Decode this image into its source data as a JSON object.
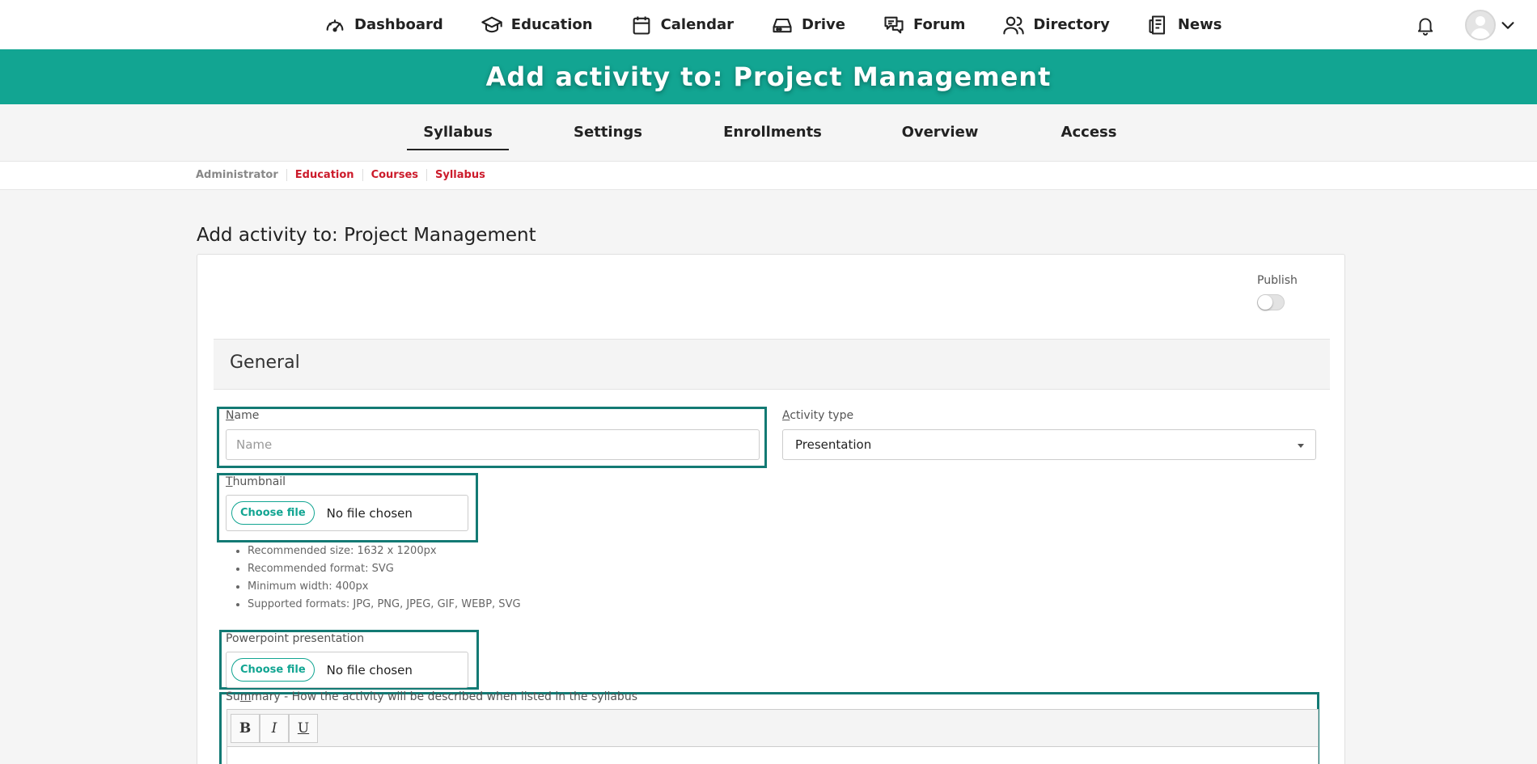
{
  "topnav": {
    "items": [
      {
        "label": "Dashboard",
        "icon": "speedometer-icon"
      },
      {
        "label": "Education",
        "icon": "graduation-cap-icon"
      },
      {
        "label": "Calendar",
        "icon": "calendar-icon"
      },
      {
        "label": "Drive",
        "icon": "drive-icon"
      },
      {
        "label": "Forum",
        "icon": "chat-bubbles-icon"
      },
      {
        "label": "Directory",
        "icon": "users-icon"
      },
      {
        "label": "News",
        "icon": "newspaper-icon"
      }
    ],
    "notification_icon": "bell-icon",
    "avatar_icon": "user-avatar-icon"
  },
  "banner": {
    "title": "Add activity to: Project Management"
  },
  "tabs": {
    "items": [
      {
        "label": "Syllabus",
        "active": true
      },
      {
        "label": "Settings",
        "active": false
      },
      {
        "label": "Enrollments",
        "active": false
      },
      {
        "label": "Overview",
        "active": false
      },
      {
        "label": "Access",
        "active": false
      }
    ]
  },
  "breadcrumb": [
    "Administrator",
    "Education",
    "Courses",
    "Syllabus"
  ],
  "page": {
    "title": "Add activity to: Project Management"
  },
  "form": {
    "publish_label": "Publish",
    "publish_on": false,
    "section_title": "General",
    "name": {
      "label_first": "N",
      "label_rest": "ame",
      "placeholder": "Name",
      "value": ""
    },
    "activity_type": {
      "label_first": "A",
      "label_rest": "ctivity type",
      "selected": "Presentation"
    },
    "thumbnail": {
      "label_first": "T",
      "label_rest": "humbnail",
      "button": "Choose file",
      "status": "No file chosen",
      "hints": [
        "Recommended size: 1632 x 1200px",
        "Recommended format: SVG",
        "Minimum width: 400px",
        "Supported formats: JPG, PNG, JPEG, GIF, WEBP, SVG"
      ]
    },
    "powerpoint": {
      "label": "Powerpoint presentation",
      "button": "Choose file",
      "status": "No file chosen"
    },
    "summary": {
      "label_pre": "Su",
      "label_underlined": "m",
      "label_rest": "mary - How the activity will be described when listed in the syllabus",
      "toolbar": {
        "bold": "B",
        "italic": "I",
        "underline": "U"
      }
    }
  },
  "colors": {
    "accent": "#12a592",
    "highlight_border": "#137a74",
    "breadcrumb_link": "#cc1b2b"
  }
}
